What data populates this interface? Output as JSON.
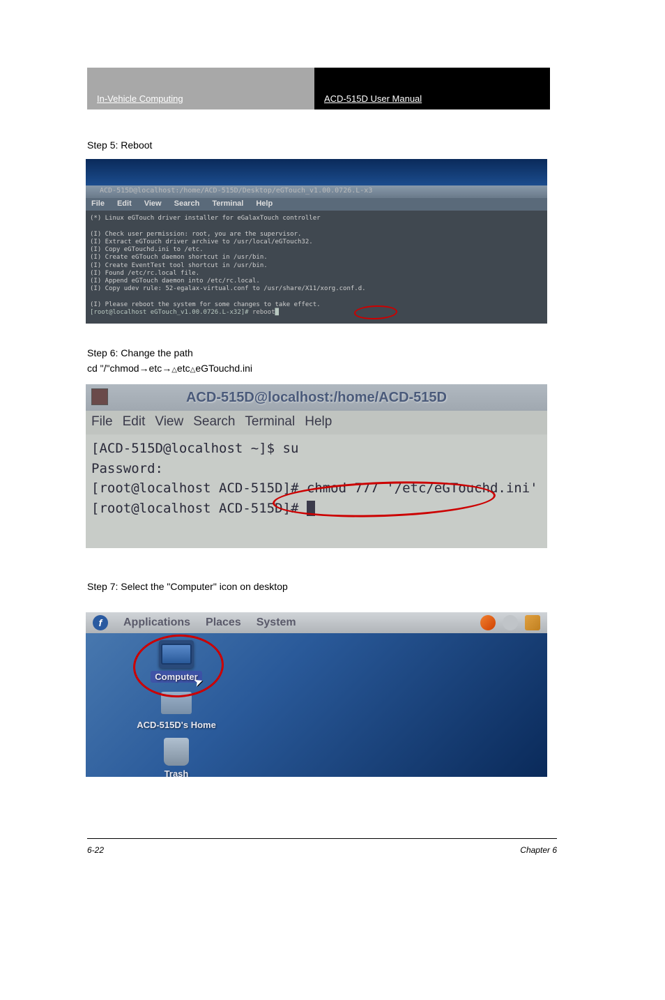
{
  "header": {
    "left": "In-Vehicle Computing",
    "right": "ACD-515D User Manual"
  },
  "steps": {
    "s5": "Step 5: Reboot",
    "s6a": "Step 6: Change the path",
    "s6b": "cd \"/\"chmod→etc→△etc△eGTouchd.ini",
    "s7": "Step 7: Select the \"Computer\" icon on desktop"
  },
  "screenshot1": {
    "title": "ACD-515D@localhost:/home/ACD-515D/Desktop/eGTouch_v1.00.0726.L-x3",
    "menu": [
      "File",
      "Edit",
      "View",
      "Search",
      "Terminal",
      "Help"
    ],
    "body": "(*) Linux eGTouch driver installer for eGalaxTouch controller\n\n(I) Check user permission: root, you are the supervisor.\n(I) Extract eGTouch driver archive to /usr/local/eGTouch32.\n(I) Copy eGTouchd.ini to /etc.\n(I) Create eGTouch daemon shortcut in /usr/bin.\n(I) Create EventTest tool shortcut in /usr/bin.\n(I) Found /etc/rc.local file.\n(I) Append eGTouch daemon into /etc/rc.local.\n(I) Copy udev rule: 52-egalax-virtual.conf to /usr/share/X11/xorg.conf.d.\n\n(I) Please reboot the system for some changes to take effect.",
    "prompt": "[root@localhost eGTouch_v1.00.0726.L-x32]# ",
    "cmd": "reboot"
  },
  "screenshot2": {
    "title": "ACD-515D@localhost:/home/ACD-515D",
    "menu": [
      "File",
      "Edit",
      "View",
      "Search",
      "Terminal",
      "Help"
    ],
    "line1": "[ACD-515D@localhost ~]$ su",
    "line2": "Password:",
    "line3": "[root@localhost ACD-515D]# chmod 777 '/etc/eGTouchd.ini'",
    "line4": "[root@localhost ACD-515D]# "
  },
  "screenshot3": {
    "panel": [
      "Applications",
      "Places",
      "System"
    ],
    "icons": {
      "computer": "Computer",
      "home": "ACD-515D's Home",
      "trash": "Trash"
    }
  },
  "footer": {
    "left": "6-22",
    "right": "Chapter 6"
  }
}
